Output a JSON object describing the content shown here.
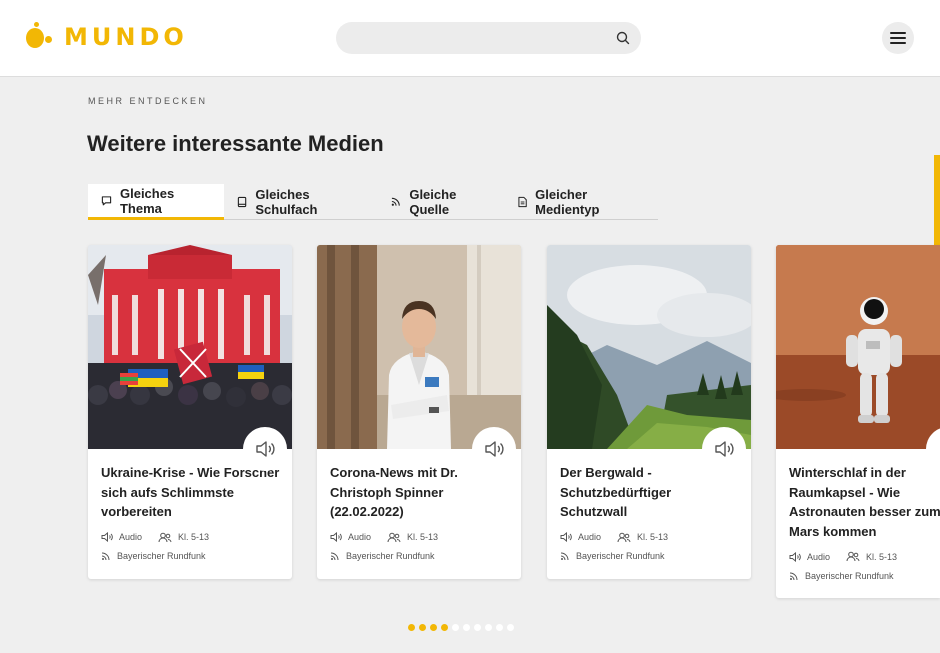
{
  "header": {
    "logo_text": "MUNDO",
    "search_placeholder": ""
  },
  "section": {
    "eyebrow": "MEHR ENTDECKEN",
    "title": "Weitere interessante Medien"
  },
  "tabs": [
    {
      "label": "Gleiches Thema",
      "active": true,
      "icon": "speech-bubble-icon"
    },
    {
      "label": "Gleiches Schulfach",
      "active": false,
      "icon": "book-icon"
    },
    {
      "label": "Gleiche Quelle",
      "active": false,
      "icon": "rss-icon"
    },
    {
      "label": "Gleicher Medientyp",
      "active": false,
      "icon": "document-icon"
    }
  ],
  "cards": [
    {
      "title": "Ukraine-Krise - Wie Forscher sich aufs Schlimmste vorbereiten",
      "type": "Audio",
      "grade": "Kl. 5-13",
      "source": "Bayerischer Rundfunk",
      "image": "crowd-protest-red-building"
    },
    {
      "title": "Corona-News mit Dr. Christoph Spinner (22.02.2022)",
      "type": "Audio",
      "grade": "Kl. 5-13",
      "source": "Bayerischer Rundfunk",
      "image": "doctor-portrait"
    },
    {
      "title": "Der Bergwald - Schutzbedürftiger Schutzwall",
      "type": "Audio",
      "grade": "Kl. 5-13",
      "source": "Bayerischer Rundfunk",
      "image": "mountain-forest"
    },
    {
      "title": "Winterschlaf in der Raumkapsel - Wie Astronauten besser zum Mars kommen",
      "type": "Audio",
      "grade": "Kl. 5-13",
      "source": "Bayerischer Rundfunk",
      "image": "astronaut-mars"
    }
  ],
  "pagination": {
    "total": 10,
    "active": [
      0,
      1,
      2,
      3
    ]
  },
  "colors": {
    "accent": "#f2b705",
    "background": "#efefef",
    "card": "#ffffff"
  }
}
